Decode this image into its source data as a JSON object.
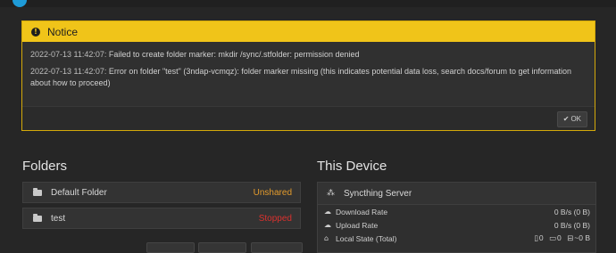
{
  "notice": {
    "title": "Notice",
    "messages": [
      {
        "timestamp": "2022-07-13 11:42:07:",
        "text": "Failed to create folder marker: mkdir /sync/.stfolder: permission denied"
      },
      {
        "timestamp": "2022-07-13 11:42:07:",
        "text": "Error on folder \"test\" (3ndap-vcmqz): folder marker missing (this indicates potential data loss, search docs/forum to get information about how to proceed)"
      }
    ],
    "ok_label": "OK"
  },
  "folders": {
    "heading": "Folders",
    "items": [
      {
        "name": "Default Folder",
        "status": "Unshared",
        "status_color": "#e39b2c"
      },
      {
        "name": "test",
        "status": "Stopped",
        "status_color": "#d9312e"
      }
    ]
  },
  "device": {
    "heading": "This Device",
    "name": "Syncthing Server",
    "stats": [
      {
        "label": "Download Rate",
        "value": "0 B/s (0 B)"
      },
      {
        "label": "Upload Rate",
        "value": "0 B/s (0 B)"
      },
      {
        "label": "Local State (Total)",
        "files": "0",
        "dirs": "0",
        "size": "~0 B"
      }
    ]
  },
  "colors": {
    "notice_header": "#f0c419",
    "background": "#262626"
  }
}
